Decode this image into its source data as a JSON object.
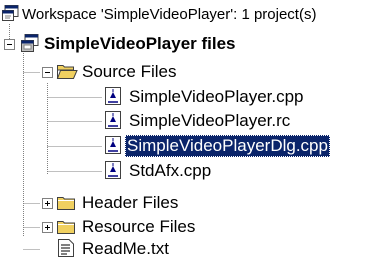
{
  "workspace": {
    "label": "Workspace 'SimpleVideoPlayer': 1 project(s)",
    "icon": "workspace-icon"
  },
  "project": {
    "label": "SimpleVideoPlayer files",
    "icon": "project-icon",
    "expanded": true
  },
  "folders": [
    {
      "label": "Source Files",
      "icon": "folder-open-icon",
      "expanded": true,
      "files": [
        {
          "label": "SimpleVideoPlayer.cpp",
          "icon": "cpp-file-icon",
          "selected": false
        },
        {
          "label": "SimpleVideoPlayer.rc",
          "icon": "rc-file-icon",
          "selected": false
        },
        {
          "label": "SimpleVideoPlayerDlg.cpp",
          "icon": "cpp-file-icon",
          "selected": true
        },
        {
          "label": "StdAfx.cpp",
          "icon": "cpp-file-icon",
          "selected": false
        }
      ]
    },
    {
      "label": "Header Files",
      "icon": "folder-closed-icon",
      "expanded": false,
      "files": []
    },
    {
      "label": "Resource Files",
      "icon": "folder-closed-icon",
      "expanded": false,
      "files": []
    }
  ],
  "loose_files": [
    {
      "label": "ReadMe.txt",
      "icon": "text-file-icon",
      "selected": false
    }
  ],
  "colors": {
    "selection_bg": "#0a246a",
    "selection_fg": "#ffffff",
    "folder_yellow": "#f0d060",
    "tree_line": "#808080"
  }
}
